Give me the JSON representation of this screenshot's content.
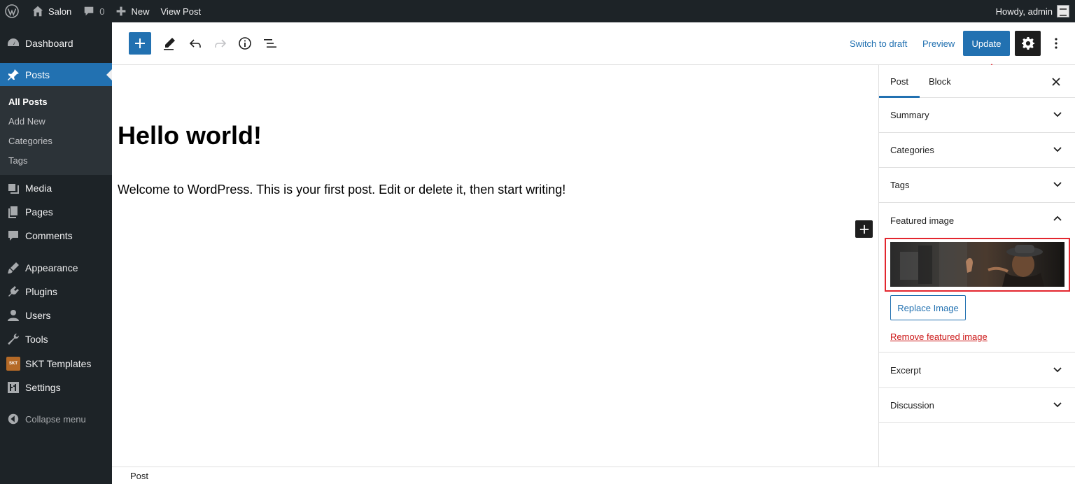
{
  "adminbar": {
    "site_name": "Salon",
    "comments_count": "0",
    "new_label": "New",
    "view_post_label": "View Post",
    "howdy_label": "Howdy, admin"
  },
  "sidebar": {
    "items": [
      {
        "label": "Dashboard",
        "icon": "dashboard-icon"
      },
      {
        "label": "Posts",
        "icon": "pin-icon",
        "active": true
      },
      {
        "label": "Media",
        "icon": "media-icon"
      },
      {
        "label": "Pages",
        "icon": "pages-icon"
      },
      {
        "label": "Comments",
        "icon": "comment-icon"
      },
      {
        "label": "Appearance",
        "icon": "brush-icon"
      },
      {
        "label": "Plugins",
        "icon": "plugin-icon"
      },
      {
        "label": "Users",
        "icon": "user-icon"
      },
      {
        "label": "Tools",
        "icon": "wrench-icon"
      },
      {
        "label": "SKT Templates",
        "icon": "skt-logo-icon"
      },
      {
        "label": "Settings",
        "icon": "settings-sliders-icon"
      }
    ],
    "submenu": [
      "All Posts",
      "Add New",
      "Categories",
      "Tags"
    ],
    "skt_logo_text": "SKT",
    "collapse_label": "Collapse menu"
  },
  "header": {
    "switch_to_draft": "Switch to draft",
    "preview": "Preview",
    "update": "Update"
  },
  "editor": {
    "title": "Hello world!",
    "paragraph": "Welcome to WordPress. This is your first post. Edit or delete it, then start writing!"
  },
  "settings_panel": {
    "tabs": [
      "Post",
      "Block"
    ],
    "sections": [
      "Summary",
      "Categories",
      "Tags",
      "Featured image",
      "Excerpt",
      "Discussion"
    ],
    "replace_image": "Replace Image",
    "remove_featured_image": "Remove featured image"
  },
  "footer": {
    "breadcrumb": "Post"
  },
  "colors": {
    "admin_dark": "#1d2327",
    "accent": "#2271b1",
    "highlight_red": "#e3262e",
    "remove_red": "#cc1818"
  }
}
